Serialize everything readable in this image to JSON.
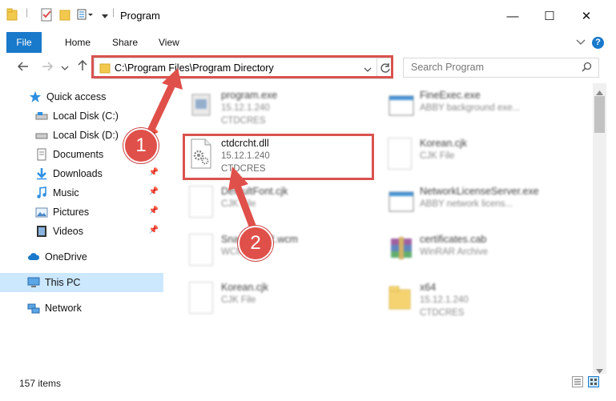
{
  "window": {
    "title": "Program",
    "minimize": "—",
    "maximize": "☐",
    "close": "✕"
  },
  "ribbon": {
    "file": "File",
    "tabs": [
      "Home",
      "Share",
      "View"
    ],
    "help": "?"
  },
  "address": {
    "path": "C:\\Program Files\\Program Directory",
    "search_placeholder": "Search Program"
  },
  "nav": {
    "quick_access": "Quick access",
    "items": [
      {
        "label": "Local Disk (C:)",
        "icon": "drive-icon",
        "pinned": false
      },
      {
        "label": "Local Disk (D:)",
        "icon": "drive-icon",
        "pinned": true
      },
      {
        "label": "Documents",
        "icon": "documents-icon",
        "pinned": true
      },
      {
        "label": "Downloads",
        "icon": "downloads-icon",
        "pinned": true
      },
      {
        "label": "Music",
        "icon": "music-icon",
        "pinned": true
      },
      {
        "label": "Pictures",
        "icon": "pictures-icon",
        "pinned": true
      },
      {
        "label": "Videos",
        "icon": "videos-icon",
        "pinned": true
      }
    ],
    "onedrive": "OneDrive",
    "this_pc": "This PC",
    "network": "Network"
  },
  "files": [
    {
      "name": "program.exe",
      "l2": "15.12.1.240",
      "l3": "CTDCRES",
      "icon": "program-icon",
      "blurred": true
    },
    {
      "name": "FineExec.exe",
      "l2": "ABBY background exe...",
      "l3": "",
      "icon": "window-icon",
      "blurred": true
    },
    {
      "name": "ctdcrcht.dll",
      "l2": "15.12.1.240",
      "l3": "CTDCRES",
      "icon": "dll-gear-icon",
      "blurred": false
    },
    {
      "name": "Korean.cjk",
      "l2": "CJK File",
      "l3": "",
      "icon": "file-icon",
      "blurred": true
    },
    {
      "name": "DefaultFont.cjk",
      "l2": "CJK File",
      "l3": "",
      "icon": "file-icon",
      "blurred": true
    },
    {
      "name": "NetworkLicenseServer.exe",
      "l2": "ABBY network licens...",
      "l3": "",
      "icon": "window-icon",
      "blurred": true
    },
    {
      "name": "Snapshot32.wcm",
      "l2": "WCM File",
      "l3": "",
      "icon": "file-icon",
      "blurred": true
    },
    {
      "name": "certificates.cab",
      "l2": "WinRAR Archive",
      "l3": "",
      "icon": "winrar-icon",
      "blurred": true
    },
    {
      "name": "Korean.cjk",
      "l2": "CJK File",
      "l3": "",
      "icon": "file-icon",
      "blurred": true
    },
    {
      "name": "x64",
      "l2": "15.12.1.240",
      "l3": "CTDCRES",
      "icon": "folder-icon",
      "blurred": true
    }
  ],
  "callouts": [
    "1",
    "2"
  ],
  "status": {
    "items": "157 items"
  },
  "colors": {
    "accent": "#1979ca",
    "highlight": "#d9534f",
    "selected": "#cce8ff"
  }
}
